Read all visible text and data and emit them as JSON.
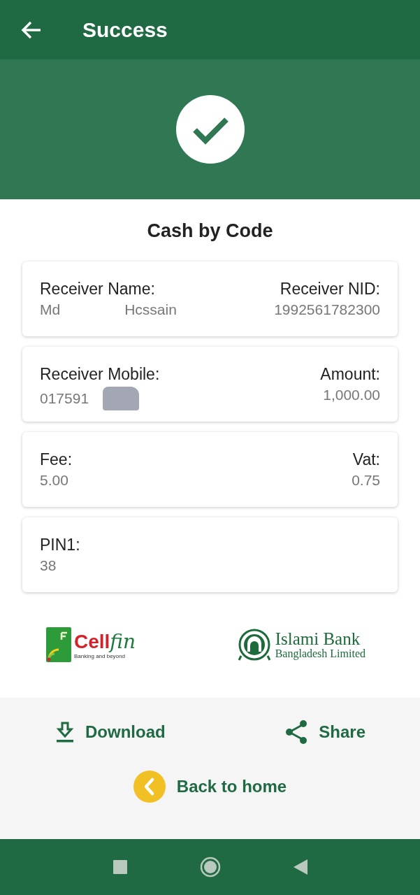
{
  "app_bar": {
    "title": "Success"
  },
  "heading": "Cash by Code",
  "cards": [
    {
      "left": {
        "label": "Receiver Name:",
        "value_parts": [
          "Md",
          "Hcssain"
        ]
      },
      "right": {
        "label": "Receiver NID:",
        "value": "1992561782300"
      }
    },
    {
      "left": {
        "label": "Receiver Mobile:",
        "value": "017591",
        "redacted": true
      },
      "right": {
        "label": "Amount:",
        "value": "1,000.00"
      }
    },
    {
      "left": {
        "label": "Fee:",
        "value": "5.00"
      },
      "right": {
        "label": "Vat:",
        "value": "0.75"
      }
    },
    {
      "left": {
        "label": "PIN1:",
        "value": "38"
      }
    }
  ],
  "logos": {
    "cellfin": {
      "name_a": "Cell",
      "name_b": "fin",
      "tagline": "Banking and beyond"
    },
    "bank": {
      "line1": "Islami Bank",
      "line2": "Bangladesh Limited"
    }
  },
  "actions": [
    {
      "kind": "download",
      "label": "Download"
    },
    {
      "kind": "share",
      "label": "Share"
    }
  ],
  "back": {
    "label": "Back to home"
  }
}
